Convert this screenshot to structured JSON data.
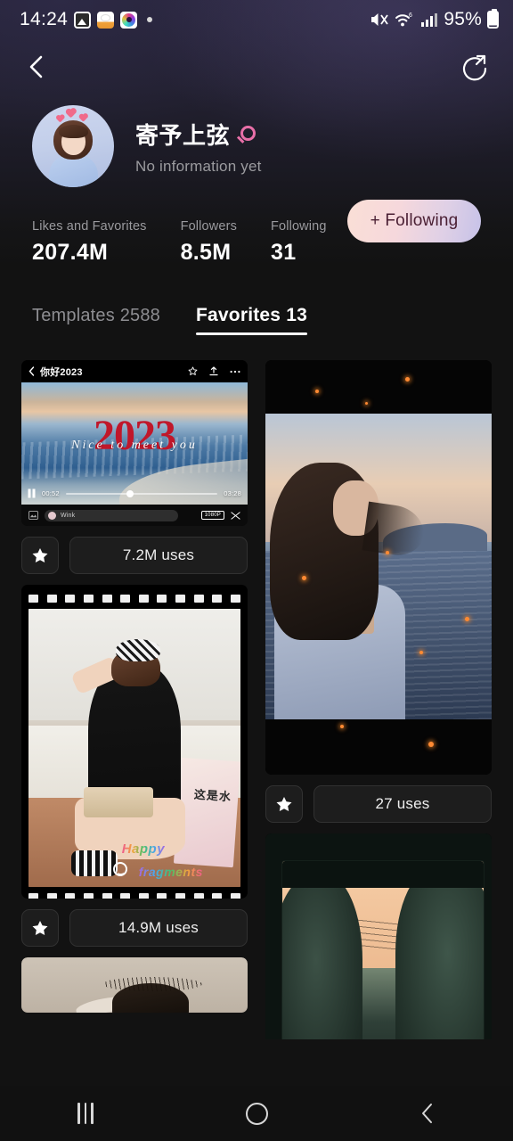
{
  "status_bar": {
    "time": "14:24",
    "battery_percent": "95%",
    "icons": [
      "gallery-icon",
      "cat-app-icon",
      "camera-app-icon",
      "notification-dot",
      "mute-icon",
      "wifi-6-icon",
      "signal-bars-icon",
      "battery-icon"
    ]
  },
  "nav": {
    "back_icon": "back-chevron-icon",
    "share_icon": "share-circle-icon"
  },
  "profile": {
    "name": "寄予上弦",
    "gender_icon": "female-gender-icon",
    "bio": "No information yet",
    "avatar": "user-avatar"
  },
  "stats": [
    {
      "label": "Likes and Favorites",
      "value": "207.4M"
    },
    {
      "label": "Followers",
      "value": "8.5M"
    },
    {
      "label": "Following",
      "value": "31"
    }
  ],
  "follow_button": {
    "label": "+ Following",
    "gradient_start": "#fadfd6",
    "gradient_end": "#c6c2e8",
    "text_color": "#4a1f33"
  },
  "tabs": [
    {
      "label": "Templates 2588",
      "active": false
    },
    {
      "label": "Favorites 13",
      "active": true
    }
  ],
  "cards": {
    "video_editor": {
      "title": "你好2023",
      "headline": "2023",
      "subtitle": "Nice to meet you",
      "current_time": "00:52",
      "total_time": "03:28",
      "watermark": "Wink",
      "resolution": "1080P",
      "uses": "7.2M uses",
      "favorite_icon": "star-filled-icon",
      "toolbar_icons": [
        "back-chevron-icon",
        "star-outline-icon",
        "upload-icon",
        "more-options-icon"
      ]
    },
    "film_strip": {
      "overlay_happy": "Happy",
      "overlay_fragments": "fragments",
      "board_text": "这是水",
      "uses": "14.9M uses",
      "favorite_icon": "star-filled-icon"
    },
    "sea_portrait": {
      "uses": "27 uses",
      "favorite_icon": "star-filled-icon"
    }
  },
  "android_nav": {
    "recents_icon": "recents-icon",
    "home_icon": "home-icon",
    "back_icon": "back-icon"
  }
}
